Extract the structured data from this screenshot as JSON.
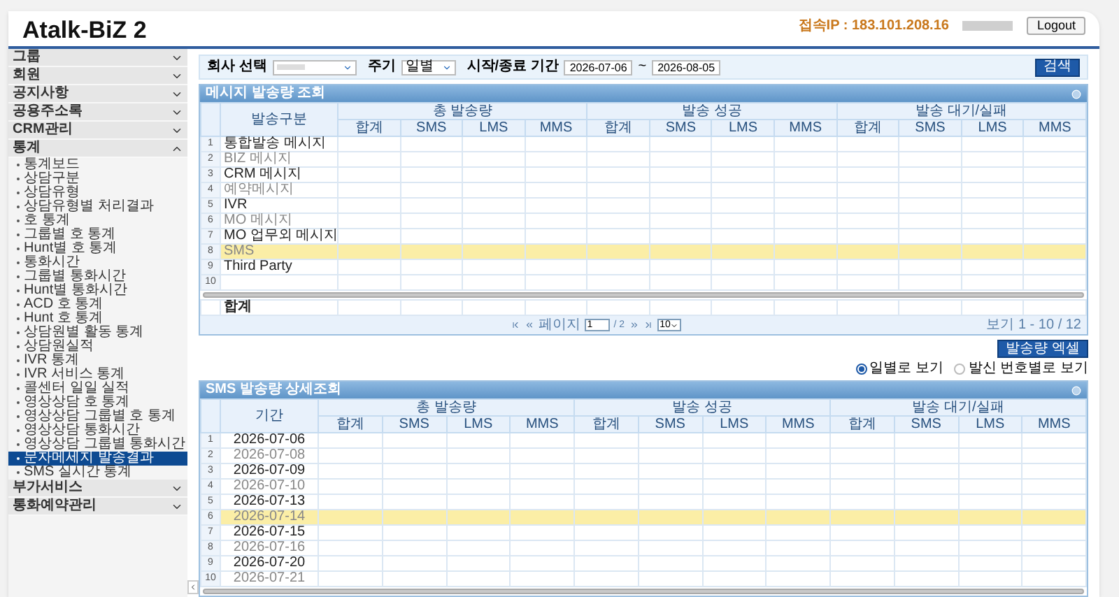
{
  "header": {
    "title": "Atalk-BiZ 2",
    "ip": "접속IP : 183.101.208.16",
    "logout": "Logout"
  },
  "sidebar": {
    "items": [
      {
        "label": "그룹",
        "expanded": false
      },
      {
        "label": "회원",
        "expanded": false
      },
      {
        "label": "공지사항",
        "expanded": false
      },
      {
        "label": "공용주소록",
        "expanded": false
      },
      {
        "label": "CRM관리",
        "expanded": false
      },
      {
        "label": "통계",
        "expanded": true,
        "children": [
          {
            "label": "통계보드",
            "selected": false
          },
          {
            "label": "상담구분",
            "selected": false
          },
          {
            "label": "상담유형",
            "selected": false
          },
          {
            "label": "상담유형별 처리결과",
            "selected": false
          },
          {
            "label": "호 통계",
            "selected": false
          },
          {
            "label": "그룹별 호 통계",
            "selected": false
          },
          {
            "label": "Hunt별 호 통계",
            "selected": false
          },
          {
            "label": "통화시간",
            "selected": false
          },
          {
            "label": "그룹별 통화시간",
            "selected": false
          },
          {
            "label": "Hunt별 통화시간",
            "selected": false
          },
          {
            "label": "ACD 호 통계",
            "selected": false
          },
          {
            "label": "Hunt 호 통계",
            "selected": false
          },
          {
            "label": "상담원별 활동 통계",
            "selected": false
          },
          {
            "label": "상담원실적",
            "selected": false
          },
          {
            "label": "IVR 통계",
            "selected": false
          },
          {
            "label": "IVR 서비스 통계",
            "selected": false
          },
          {
            "label": "콜센터 일일 실적",
            "selected": false
          },
          {
            "label": "영상상담 호 통계",
            "selected": false
          },
          {
            "label": "영상상담 그룹별 호 통계",
            "selected": false
          },
          {
            "label": "영상상담 통화시간",
            "selected": false
          },
          {
            "label": "영상상담 그룹별 통화시간",
            "selected": false
          },
          {
            "label": "문자메세지 발송결과",
            "selected": true
          },
          {
            "label": "SMS 실시간 통계",
            "selected": false
          }
        ]
      },
      {
        "label": "부가서비스",
        "expanded": false
      },
      {
        "label": "통화예약관리",
        "expanded": false
      }
    ]
  },
  "filter": {
    "company_label": "회사 선택",
    "period_label": "주기",
    "period_value": "일별",
    "date_label": "시작/종료 기간",
    "start_date": "2026-07-06",
    "separator": "~",
    "end_date": "2026-08-05",
    "search_button": "검색"
  },
  "grid1": {
    "title": "메시지 발송량 조회",
    "row_header": "발송구분",
    "groups": [
      {
        "label": "총 발송량",
        "columns": [
          "합계",
          "SMS",
          "LMS",
          "MMS"
        ]
      },
      {
        "label": "발송 성공",
        "columns": [
          "합계",
          "SMS",
          "LMS",
          "MMS"
        ]
      },
      {
        "label": "발송 대기/실패",
        "columns": [
          "합계",
          "SMS",
          "LMS",
          "MMS"
        ]
      }
    ],
    "rows": [
      {
        "num": "1",
        "label": "통합발송 메시지",
        "selected": false
      },
      {
        "num": "2",
        "label": "BIZ 메시지",
        "selected": false
      },
      {
        "num": "3",
        "label": "CRM 메시지",
        "selected": false
      },
      {
        "num": "4",
        "label": "예약메시지",
        "selected": false
      },
      {
        "num": "5",
        "label": "IVR",
        "selected": false
      },
      {
        "num": "6",
        "label": "MO 메시지",
        "selected": false
      },
      {
        "num": "7",
        "label": "MO 업무외 메시지",
        "selected": false
      },
      {
        "num": "8",
        "label": "SMS",
        "selected": true
      },
      {
        "num": "9",
        "label": "Third Party",
        "selected": false
      },
      {
        "num": "10",
        "label": "",
        "selected": false
      }
    ],
    "total_label": "합계",
    "pager": {
      "page_label": "페이지",
      "page": "1",
      "of": "/ 2",
      "page_size": "10",
      "summary": "보기 1 - 10 / 12"
    }
  },
  "excel_button": "발송량 엑셀",
  "view_options": [
    {
      "label": "일별로 보기",
      "selected": true
    },
    {
      "label": "발신 번호별로 보기",
      "selected": false
    }
  ],
  "grid2": {
    "title": "SMS 발송량 상세조회",
    "row_header": "기간",
    "groups": [
      {
        "label": "총 발송량",
        "columns": [
          "합계",
          "SMS",
          "LMS",
          "MMS"
        ]
      },
      {
        "label": "발송 성공",
        "columns": [
          "합계",
          "SMS",
          "LMS",
          "MMS"
        ]
      },
      {
        "label": "발송 대기/실패",
        "columns": [
          "합계",
          "SMS",
          "LMS",
          "MMS"
        ]
      }
    ],
    "rows": [
      {
        "num": "1",
        "label": "2026-07-06",
        "selected": false
      },
      {
        "num": "2",
        "label": "2026-07-08",
        "selected": false
      },
      {
        "num": "3",
        "label": "2026-07-09",
        "selected": false
      },
      {
        "num": "4",
        "label": "2026-07-10",
        "selected": false
      },
      {
        "num": "5",
        "label": "2026-07-13",
        "selected": false
      },
      {
        "num": "6",
        "label": "2026-07-14",
        "selected": true
      },
      {
        "num": "7",
        "label": "2026-07-15",
        "selected": false
      },
      {
        "num": "8",
        "label": "2026-07-16",
        "selected": false
      },
      {
        "num": "9",
        "label": "2026-07-20",
        "selected": false
      },
      {
        "num": "10",
        "label": "2026-07-21",
        "selected": false
      }
    ]
  }
}
